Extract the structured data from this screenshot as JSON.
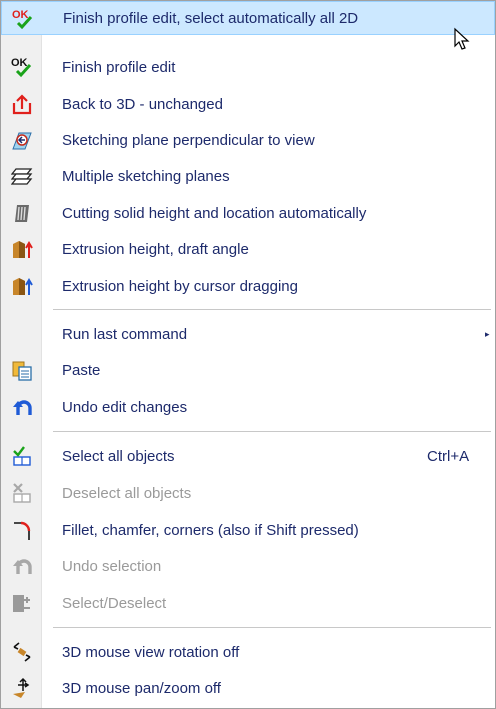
{
  "menu": {
    "items": [
      {
        "label": "Finish profile edit, select automatically all 2D",
        "icon": "ok-check-icon"
      },
      {
        "label": "Finish profile edit",
        "icon": "ok-check-icon"
      },
      {
        "label": "Back to 3D - unchanged",
        "icon": "back-to-3d-icon"
      },
      {
        "label": "Sketching plane perpendicular to view",
        "icon": "sketch-plane-view-icon"
      },
      {
        "label": "Multiple sketching planes",
        "icon": "multiple-planes-icon"
      },
      {
        "label": "Cutting solid height and location automatically",
        "icon": "cutting-solid-icon"
      },
      {
        "label": "Extrusion height, draft angle",
        "icon": "extrusion-draft-icon"
      },
      {
        "label": "Extrusion height by cursor dragging",
        "icon": "extrusion-drag-icon"
      },
      {
        "label": "Run last command",
        "icon": "",
        "arrow": "▸"
      },
      {
        "label": "Paste",
        "icon": "paste-icon"
      },
      {
        "label": "Undo edit changes",
        "icon": "undo-icon"
      },
      {
        "label": "Select all objects",
        "icon": "select-all-icon",
        "shortcut": "Ctrl+A"
      },
      {
        "label": "Deselect all objects",
        "icon": "deselect-all-icon",
        "disabled": true
      },
      {
        "label": "Fillet, chamfer, corners (also if Shift pressed)",
        "icon": "fillet-icon"
      },
      {
        "label": "Undo selection",
        "icon": "undo-selection-icon",
        "disabled": true
      },
      {
        "label": "Select/Deselect",
        "icon": "select-deselect-icon",
        "disabled": true
      },
      {
        "label": "3D mouse view rotation off",
        "icon": "rotation-off-icon"
      },
      {
        "label": "3D mouse pan/zoom off",
        "icon": "pan-zoom-off-icon"
      }
    ]
  },
  "colors": {
    "highlight": "#cce8ff",
    "text": "#1d2a6b",
    "disabled_text": "#9a9a9a",
    "ok_red": "#e0201c",
    "check_green": "#1aa31a"
  }
}
